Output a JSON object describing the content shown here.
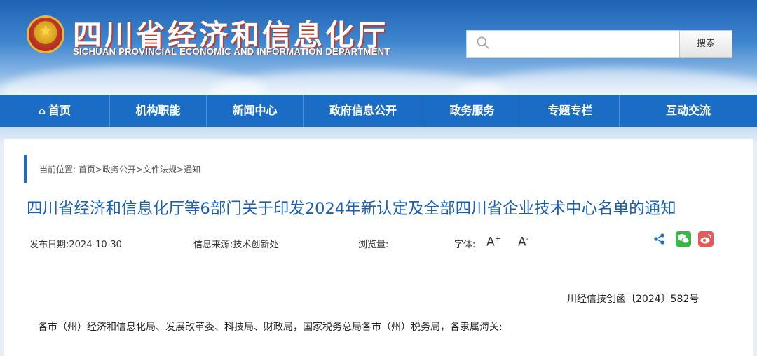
{
  "header": {
    "title": "四川省经济和信息化厅",
    "subtitle": "SICHUAN PROVINCIAL ECONOMIC AND INFORMATION DEPARTMENT",
    "emblem_icon": "national-emblem-icon",
    "colors": {
      "primary": "#1a6cc4",
      "title_shadow": "#c23a2a"
    }
  },
  "search": {
    "value": "",
    "placeholder": "",
    "button_label": "搜索"
  },
  "nav": {
    "items": [
      {
        "label": "首页",
        "icon": "home-icon"
      },
      {
        "label": "机构职能"
      },
      {
        "label": "新闻中心"
      },
      {
        "label": "政府信息公开"
      },
      {
        "label": "政务服务"
      },
      {
        "label": "专题专栏"
      },
      {
        "label": "互动交流"
      }
    ]
  },
  "breadcrumb": {
    "prefix": "当前位置:",
    "items": [
      "首页",
      "政务公开",
      "文件法规",
      "通知"
    ],
    "separator": ">"
  },
  "article": {
    "title": "四川省经济和信息化厅等6部门关于印发2024年新认定及全部四川省企业技术中心名单的通知",
    "publish_date_label": "发布日期:",
    "publish_date": "2024-10-30",
    "source_label": "信息来源:",
    "source": "技术创新处",
    "views_label": "浏览量:",
    "views": "",
    "font_label": "字体:",
    "font_increase": "A",
    "font_decrease": "A",
    "font_increase_mark": "+",
    "font_decrease_mark": "-",
    "share_icons": [
      "share-icon",
      "wechat-icon",
      "weibo-icon"
    ],
    "doc_number": "川经信技创函〔2024〕582号",
    "salutation": "各市（州）经济和信息化局、发展改革委、科技局、财政局，国家税务总局各市（州）税务局，各隶属海关:"
  }
}
